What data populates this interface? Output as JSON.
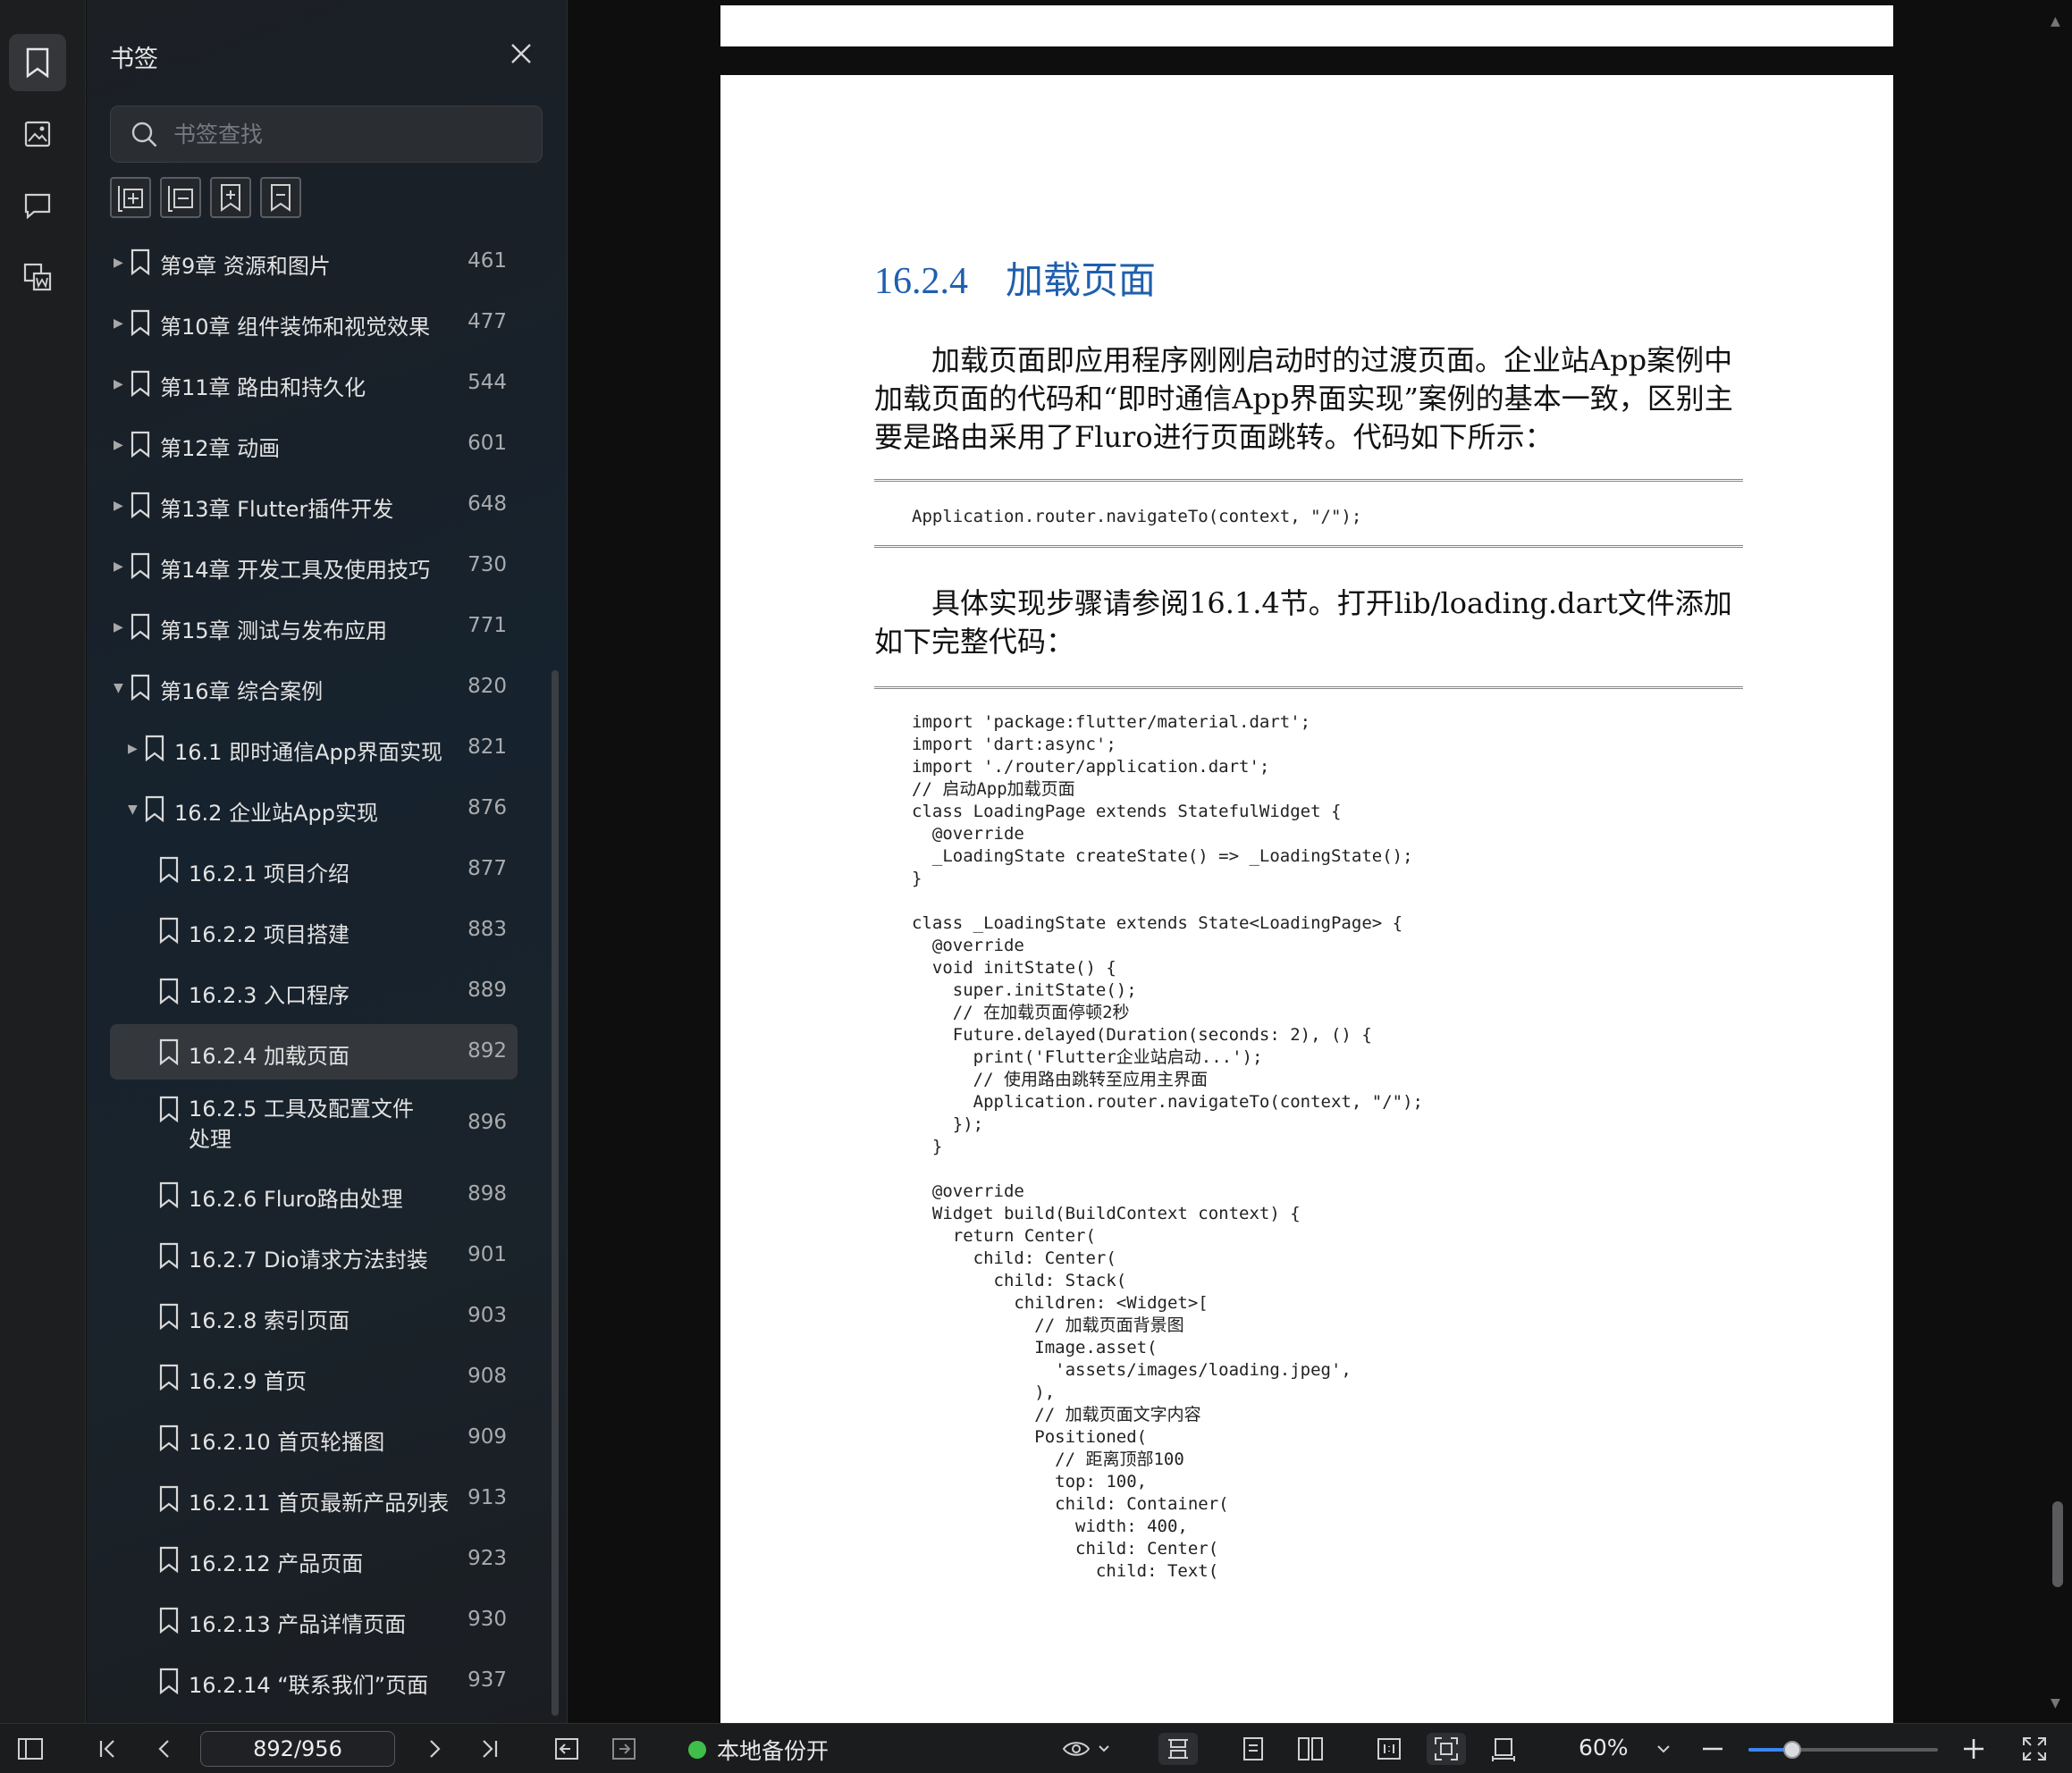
{
  "panel": {
    "title": "书签",
    "search_placeholder": "书签查找"
  },
  "bookmarks": [
    {
      "label": "第9章 资源和图片",
      "page": "461",
      "level": 0,
      "caret": "right"
    },
    {
      "label": "第10章 组件装饰和视觉效果",
      "page": "477",
      "level": 0,
      "caret": "right"
    },
    {
      "label": "第11章 路由和持久化",
      "page": "544",
      "level": 0,
      "caret": "right"
    },
    {
      "label": "第12章 动画",
      "page": "601",
      "level": 0,
      "caret": "right"
    },
    {
      "label": "第13章 Flutter插件开发",
      "page": "648",
      "level": 0,
      "caret": "right"
    },
    {
      "label": "第14章 开发工具及使用技巧",
      "page": "730",
      "level": 0,
      "caret": "right"
    },
    {
      "label": "第15章 测试与发布应用",
      "page": "771",
      "level": 0,
      "caret": "right"
    },
    {
      "label": "第16章 综合案例",
      "page": "820",
      "level": 0,
      "caret": "down"
    },
    {
      "label": "16.1 即时通信App界面实现",
      "page": "821",
      "level": 1,
      "caret": "right"
    },
    {
      "label": "16.2 企业站App实现",
      "page": "876",
      "level": 1,
      "caret": "down"
    },
    {
      "label": "16.2.1 项目介绍",
      "page": "877",
      "level": 2,
      "caret": ""
    },
    {
      "label": "16.2.2 项目搭建",
      "page": "883",
      "level": 2,
      "caret": ""
    },
    {
      "label": "16.2.3 入口程序",
      "page": "889",
      "level": 2,
      "caret": ""
    },
    {
      "label": "16.2.4 加载页面",
      "page": "892",
      "level": 2,
      "caret": "",
      "selected": true
    },
    {
      "label": "16.2.5 工具及配置文件处理",
      "page": "896",
      "level": 2,
      "caret": "",
      "wrap": true
    },
    {
      "label": "16.2.6 Fluro路由处理",
      "page": "898",
      "level": 2,
      "caret": ""
    },
    {
      "label": "16.2.7 Dio请求方法封装",
      "page": "901",
      "level": 2,
      "caret": ""
    },
    {
      "label": "16.2.8 索引页面",
      "page": "903",
      "level": 2,
      "caret": ""
    },
    {
      "label": "16.2.9 首页",
      "page": "908",
      "level": 2,
      "caret": ""
    },
    {
      "label": "16.2.10 首页轮播图",
      "page": "909",
      "level": 2,
      "caret": ""
    },
    {
      "label": "16.2.11 首页最新产品列表",
      "page": "913",
      "level": 2,
      "caret": ""
    },
    {
      "label": "16.2.12 产品页面",
      "page": "923",
      "level": 2,
      "caret": ""
    },
    {
      "label": "16.2.13 产品详情页面",
      "page": "930",
      "level": 2,
      "caret": ""
    },
    {
      "label": "16.2.14 “联系我们”页面",
      "page": "937",
      "level": 2,
      "caret": ""
    }
  ],
  "document": {
    "section_number": "16.2.4",
    "section_title": "加载页面",
    "para1": "加载页面即应用程序刚刚启动时的过渡页面。企业站App案例中加载页面的代码和“即时通信App界面实现”案例的基本一致，区别主要是路由采用了Fluro进行页面跳转。代码如下所示：",
    "code1": "Application.router.navigateTo(context, \"/\");",
    "para2": "具体实现步骤请参阅16.1.4节。打开lib/loading.dart文件添加如下完整代码：",
    "code2": "import 'package:flutter/material.dart';\nimport 'dart:async';\nimport './router/application.dart';\n// 启动App加载页面\nclass LoadingPage extends StatefulWidget {\n  @override\n  _LoadingState createState() => _LoadingState();\n}\n\nclass _LoadingState extends State<LoadingPage> {\n  @override\n  void initState() {\n    super.initState();\n    // 在加载页面停顿2秒\n    Future.delayed(Duration(seconds: 2), () {\n      print('Flutter企业站启动...');\n      // 使用路由跳转至应用主界面\n      Application.router.navigateTo(context, \"/\");\n    });\n  }\n\n  @override\n  Widget build(BuildContext context) {\n    return Center(\n      child: Center(\n        child: Stack(\n          children: <Widget>[\n            // 加载页面背景图\n            Image.asset(\n              'assets/images/loading.jpeg',\n            ),\n            // 加载页面文字内容\n            Positioned(\n              // 距离顶部100\n              top: 100,\n              child: Container(\n                width: 400,\n                child: Center(\n                  child: Text("
  },
  "statusbar": {
    "page_indicator": "892/956",
    "backup_label": "本地备份开",
    "zoom_label": "60%",
    "zoom_level": 0.23
  },
  "colors": {
    "accent": "#3d86f0",
    "heading_blue": "#1f5fae",
    "backup_dot": "#3fbf4a"
  }
}
